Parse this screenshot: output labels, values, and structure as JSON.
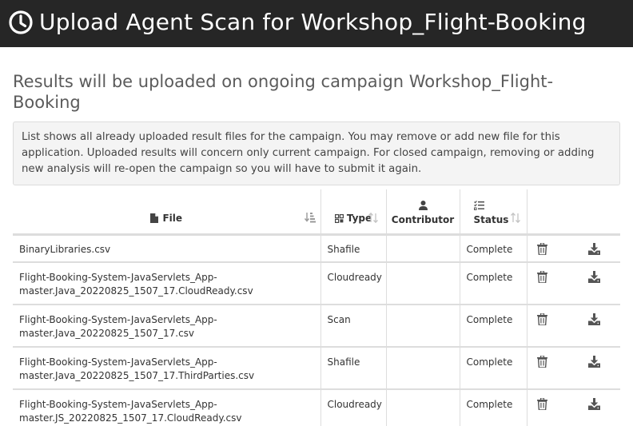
{
  "header": {
    "title": "Upload Agent Scan for Workshop_Flight-Booking",
    "icon": "clock-icon"
  },
  "subtitle": "Results will be uploaded on ongoing campaign Workshop_Flight-Booking",
  "notice": "List shows all already uploaded result files for the campaign. You may remove or add new file for this application. Uploaded results will concern only current campaign. For closed campaign, removing or adding new analysis will re-open the campaign so you will have to submit it again.",
  "table": {
    "columns": {
      "file": "File",
      "type": "Type",
      "contributor": "Contributor",
      "status": "Status"
    },
    "rows": [
      {
        "file": "BinaryLibraries.csv",
        "type": "Shafile",
        "contributor": "",
        "status": "Complete"
      },
      {
        "file": "Flight-Booking-System-JavaServlets_App-master.Java_20220825_1507_17.CloudReady.csv",
        "type": "Cloudready",
        "contributor": "",
        "status": "Complete"
      },
      {
        "file": "Flight-Booking-System-JavaServlets_App-master.Java_20220825_1507_17.csv",
        "type": "Scan",
        "contributor": "",
        "status": "Complete"
      },
      {
        "file": "Flight-Booking-System-JavaServlets_App-master.Java_20220825_1507_17.ThirdParties.csv",
        "type": "Shafile",
        "contributor": "",
        "status": "Complete"
      },
      {
        "file": "Flight-Booking-System-JavaServlets_App-master.JS_20220825_1507_17.CloudReady.csv",
        "type": "Cloudready",
        "contributor": "",
        "status": "Complete"
      }
    ]
  },
  "colors": {
    "header_bg": "#262626",
    "header_text": "#ffffff",
    "notice_bg": "#f4f4f4",
    "border": "#dddddd"
  }
}
